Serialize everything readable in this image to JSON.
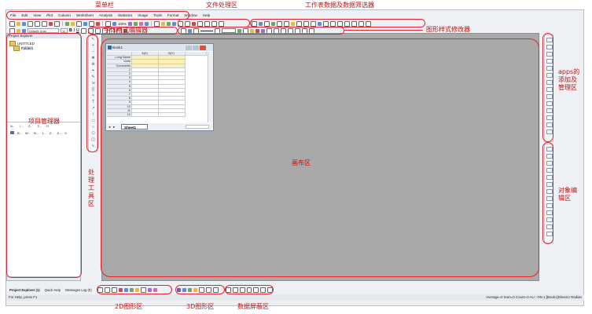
{
  "annotations": {
    "menubar": "菜单栏",
    "file_area": "文件处理区",
    "worksheet_filter": "工作表数据及数据筛选器",
    "graph_style": "图形样式修改器",
    "font_format": "字体格式编辑器",
    "apps": [
      "apps的",
      "添加及",
      "管理区"
    ],
    "object_edit": [
      "对象编",
      "辑区"
    ],
    "project_manager": "项目管理器",
    "tools_area": [
      "处",
      "理",
      "工",
      "具",
      "区"
    ],
    "canvas": "画布区",
    "graph2d": "2D图形区",
    "graph3d": "3D图形区",
    "data_screen": "数据屏蔽区"
  },
  "menu": [
    "File",
    "Edit",
    "View",
    "Plot",
    "Column",
    "Worksheet",
    "Analysis",
    "Statistics",
    "Image",
    "Tools",
    "Format",
    "Window",
    "Help"
  ],
  "toolbar": {
    "zoom": "100%",
    "font_name": "Default: Arial",
    "font_size": "12"
  },
  "project_explorer": {
    "title": "Project Explorer",
    "root": "UNTITLED",
    "folder": "Folder1",
    "columns": [
      "N...",
      "I...",
      "Z...",
      "Z...",
      "D"
    ],
    "row": [
      "B...",
      "W...",
      "N...",
      "1...",
      "Z...",
      "Z...",
      "0"
    ]
  },
  "workbook": {
    "title": "Book1",
    "col_a": "A(X)",
    "col_b": "B(Y)",
    "meta_rows": [
      "Long Name",
      "Units",
      "Comments"
    ],
    "rows": [
      "1",
      "2",
      "3",
      "4",
      "5",
      "6",
      "7",
      "8",
      "9",
      "10",
      "11",
      "12"
    ],
    "sheet": "Sheet1"
  },
  "bottom_tabs": [
    "Project Explorer (1)",
    "Quick Help",
    "Messages Log (0)"
  ],
  "status": {
    "left": "For Help, press F1",
    "right": "Average=0 Sum=0 Count=0 AU : ON     1:[Book1]Sheet1! Radian"
  },
  "colors": {
    "annotation": "#e2262f",
    "canvas": "#a9a9a9",
    "meta_cell": "#f9f1b8"
  }
}
